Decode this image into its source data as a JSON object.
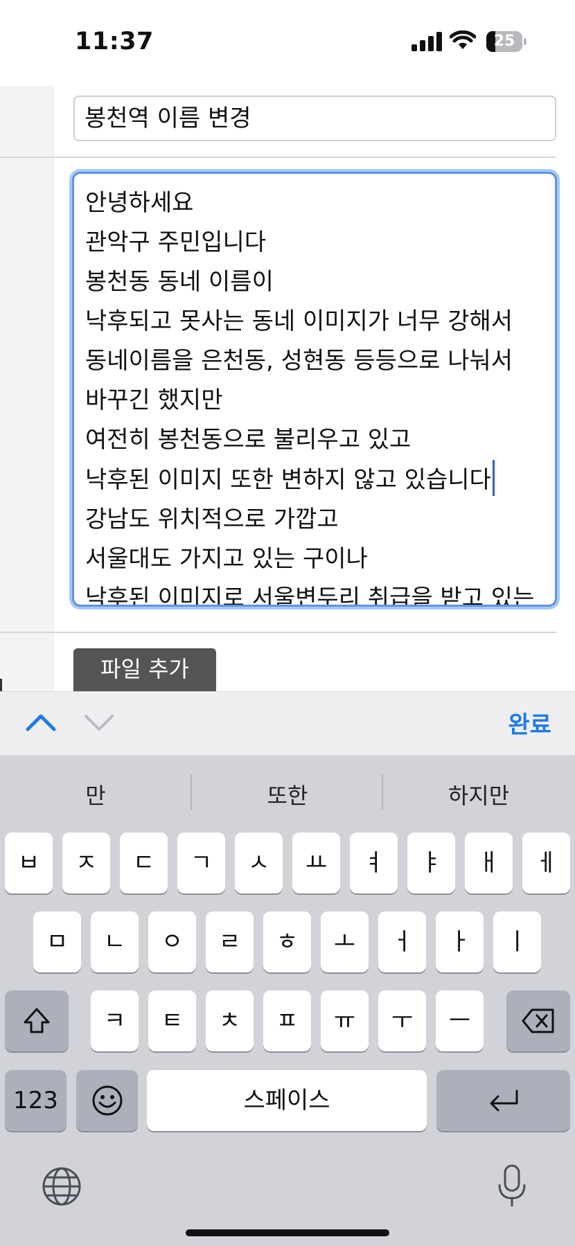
{
  "status_bar": {
    "time": "11:37",
    "battery_level": "25",
    "battery_fraction": 0.25,
    "icons": [
      "cellular-signal-icon",
      "wifi-icon",
      "battery-icon"
    ]
  },
  "form": {
    "title_value": "봉천역 이름 변경",
    "body_lines": [
      "안녕하세요",
      "관악구 주민입니다",
      "봉천동 동네 이름이",
      "낙후되고 못사는 동네 이미지가 너무 강해서",
      "동네이름을 은천동, 성현동 등등으로 나눠서",
      "바꾸긴 했지만",
      "여전히 봉천동으로 불리우고 있고",
      "낙후된 이미지 또한 변하지 않고 있습니다",
      "강남도 위치적으로 가깝고",
      "서울대도 가지고 있는 구이나",
      "낙후된 이미지로 서울변두리 취급을 받고 있는"
    ],
    "file_button_label": "파일 추가"
  },
  "accessory_bar": {
    "done_label": "완료",
    "icons": [
      "chevron-up-icon",
      "chevron-down-icon"
    ]
  },
  "keyboard": {
    "suggestions": [
      "만",
      "또한",
      "하지만"
    ],
    "row1": [
      "ㅂ",
      "ㅈ",
      "ㄷ",
      "ㄱ",
      "ㅅ",
      "ㅛ",
      "ㅕ",
      "ㅑ",
      "ㅐ",
      "ㅔ"
    ],
    "row2": [
      "ㅁ",
      "ㄴ",
      "ㅇ",
      "ㄹ",
      "ㅎ",
      "ㅗ",
      "ㅓ",
      "ㅏ",
      "ㅣ"
    ],
    "row3": [
      "ㅋ",
      "ㅌ",
      "ㅊ",
      "ㅍ",
      "ㅠ",
      "ㅜ",
      "ㅡ"
    ],
    "numbers_label": "123",
    "space_label": "스페이스",
    "special_icons": [
      "shift-icon",
      "backspace-icon",
      "emoji-icon",
      "return-icon",
      "globe-icon",
      "microphone-icon"
    ]
  },
  "colors": {
    "accent": "#1f7ae8",
    "focus_border": "#5b93e6",
    "keyboard_bg": "#d1d3d9",
    "file_button_bg": "#555555"
  }
}
